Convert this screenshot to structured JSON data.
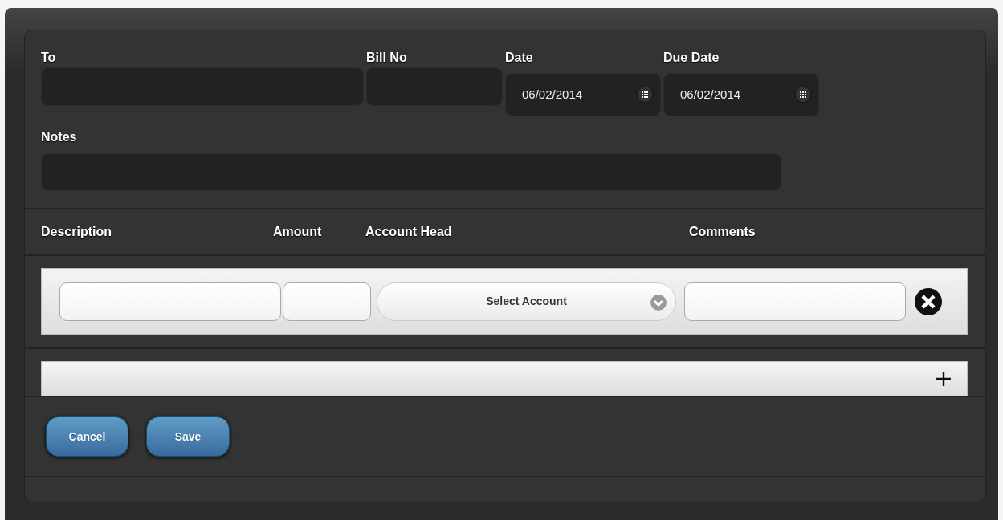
{
  "header_fields": [
    {
      "label": "To",
      "kind": "text"
    },
    {
      "label": "Bill No",
      "kind": "text"
    },
    {
      "label": "Date",
      "kind": "date",
      "value": "06/02/2014"
    },
    {
      "label": "Due Date",
      "kind": "date",
      "value": "06/02/2014"
    }
  ],
  "notes": {
    "label": "Notes"
  },
  "line_columns": [
    "Description",
    "Amount",
    "Account Head",
    "Comments"
  ],
  "line_items": [
    {
      "account_select": "Select Account"
    }
  ],
  "buttons": [
    "Cancel",
    "Save"
  ]
}
